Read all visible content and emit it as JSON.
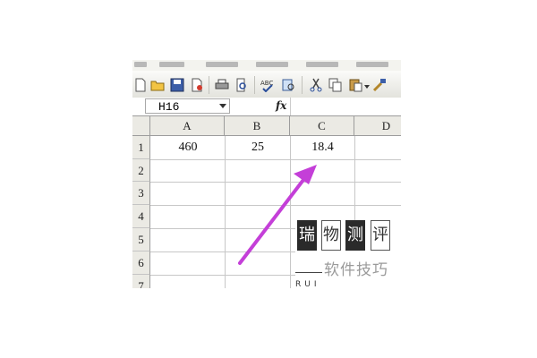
{
  "formula_bar": {
    "name_box_value": "H16",
    "fx_label": "fx"
  },
  "toolbar": {
    "icons": [
      "new-icon",
      "open-icon",
      "save-icon",
      "permission-icon",
      "print-icon",
      "print-preview-icon",
      "spelling-icon",
      "research-icon",
      "cut-icon",
      "copy-icon",
      "paste-icon",
      "format-painter-icon"
    ]
  },
  "grid": {
    "columns": [
      "A",
      "B",
      "C",
      "D"
    ],
    "rows": [
      "1",
      "2",
      "3",
      "4",
      "5",
      "6",
      "7"
    ],
    "row1": {
      "A": "460",
      "B": "25",
      "C": "18.4"
    }
  },
  "annotation": {
    "arrow_color": "#c43fd8"
  },
  "watermark": {
    "glyphs": [
      "瑞",
      "物",
      "测",
      "评"
    ],
    "subtitle": "软件技巧",
    "latin": "RUI"
  }
}
